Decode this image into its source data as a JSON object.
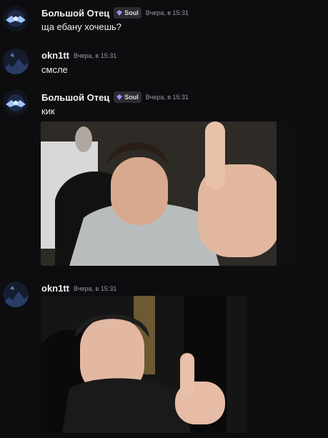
{
  "messages": [
    {
      "author": "Большой Отец",
      "badge": "Soul",
      "time": "Вчера, в 15:31",
      "text": "ща ебану хочешь?"
    },
    {
      "author": "okn1tt",
      "time": "Вчера, в 15:31",
      "text": "смсле"
    },
    {
      "author": "Большой Отец",
      "badge": "Soul",
      "time": "Вчера, в 15:31",
      "text": "кик"
    },
    {
      "author": "okn1tt",
      "time": "Вчера, в 15:31"
    }
  ],
  "colors": {
    "background": "#0d0d10",
    "badge_gem": "#a78bfa",
    "timestamp": "#949ba4"
  },
  "icons": {
    "badge": "purple-gem-icon"
  }
}
